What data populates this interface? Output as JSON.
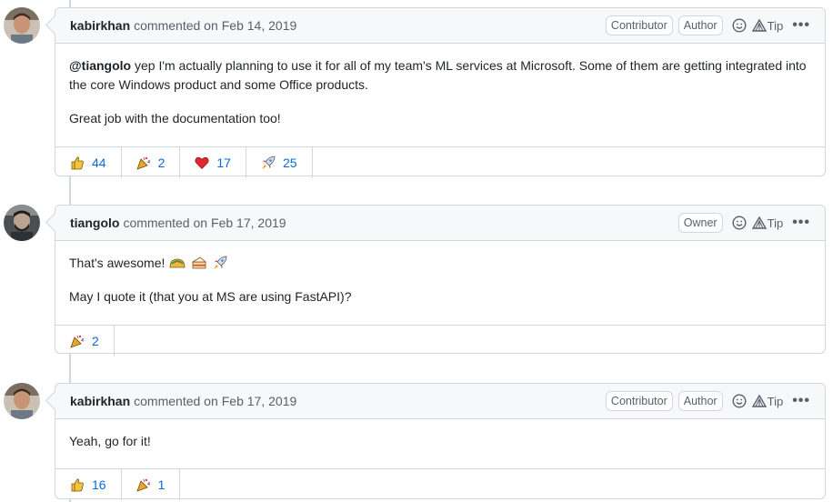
{
  "comments": [
    {
      "author": "kabirkhan",
      "action": "commented on",
      "date": "Feb 14, 2019",
      "badges": [
        "Contributor",
        "Author"
      ],
      "tip_label": "Tip",
      "mention": "@tiangolo",
      "paragraph1": " yep I'm actually planning to use it for all of my team's ML services at Microsoft. Some of them are getting integrated into the core Windows product and some Office products.",
      "paragraph2": "Great job with the documentation too!",
      "reactions": [
        {
          "icon": "thumbs-up-icon",
          "count": "44"
        },
        {
          "icon": "tada-icon",
          "count": "2"
        },
        {
          "icon": "heart-icon",
          "count": "17"
        },
        {
          "icon": "rocket-icon",
          "count": "25"
        }
      ]
    },
    {
      "author": "tiangolo",
      "action": "commented on",
      "date": "Feb 17, 2019",
      "badges": [
        "Owner"
      ],
      "tip_label": "Tip",
      "paragraph1": "That's awesome! ",
      "paragraph2": "May I quote it (that you at MS are using FastAPI)?",
      "reactions": [
        {
          "icon": "tada-icon",
          "count": "2"
        }
      ]
    },
    {
      "author": "kabirkhan",
      "action": "commented on",
      "date": "Feb 17, 2019",
      "badges": [
        "Contributor",
        "Author"
      ],
      "tip_label": "Tip",
      "paragraph1": "Yeah, go for it!",
      "reactions": [
        {
          "icon": "thumbs-up-icon",
          "count": "16"
        },
        {
          "icon": "tada-icon",
          "count": "1"
        }
      ]
    }
  ],
  "colors": {
    "link": "#0969da",
    "border": "#d0d7de",
    "header_bg": "#f6f8fa",
    "muted": "#57606a"
  }
}
